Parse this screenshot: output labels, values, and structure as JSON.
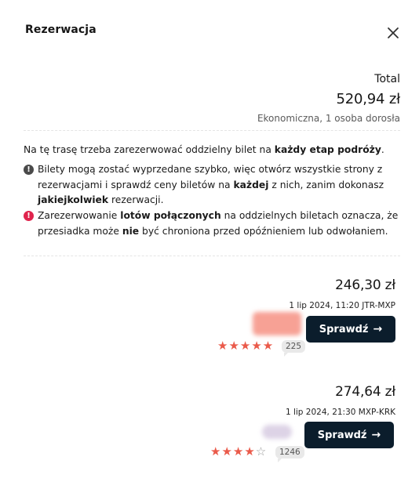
{
  "header": {
    "title": "Rezerwacja"
  },
  "summary": {
    "total_label": "Total",
    "total_price": "520,94 zł",
    "details": "Ekonomiczna, 1 osoba dorosła"
  },
  "notice": {
    "intro_prefix": "Na tę trasę trzeba zarezerwować oddzielny bilet na ",
    "intro_bold": "każdy etap podróży",
    "intro_suffix": ".",
    "warning1": {
      "icon": "info-circle-icon",
      "color": "#4a4a4a",
      "line_a": "Bilety mogą zostać wyprzedane szybko, więc otwórz wszystkie strony z",
      "line_b_prefix": "rezerwacjami i sprawdź ceny biletów na ",
      "line_b_bold": "każdej",
      "line_b_suffix": " z nich, zanim dokonasz",
      "line_c_bold": "jakiejkolwiek",
      "line_c_suffix": " rezerwacji."
    },
    "warning2": {
      "icon": "alert-circle-icon",
      "color": "#e0244d",
      "line_a_prefix": "Zarezerwowanie ",
      "line_a_bold": "lotów połączonych",
      "line_a_suffix": " na oddzielnych biletach oznacza, że",
      "line_b_prefix": "przesiadka może ",
      "line_b_bold": "nie",
      "line_b_suffix": " być chroniona przed opóźnieniem lub odwołaniem."
    }
  },
  "offers": [
    {
      "price": "246,30 zł",
      "flight": "1 lip 2024, 11:20 JTR-MXP",
      "button_label": "Sprawdź",
      "rating_stars": 5,
      "review_count": "225",
      "logo_color": "#f7a195"
    },
    {
      "price": "274,64 zł",
      "flight": "1 lip 2024, 21:30 MXP-KRK",
      "button_label": "Sprawdź",
      "rating_stars": 4,
      "review_count": "1246",
      "logo_color": "#ddd3e6"
    }
  ]
}
